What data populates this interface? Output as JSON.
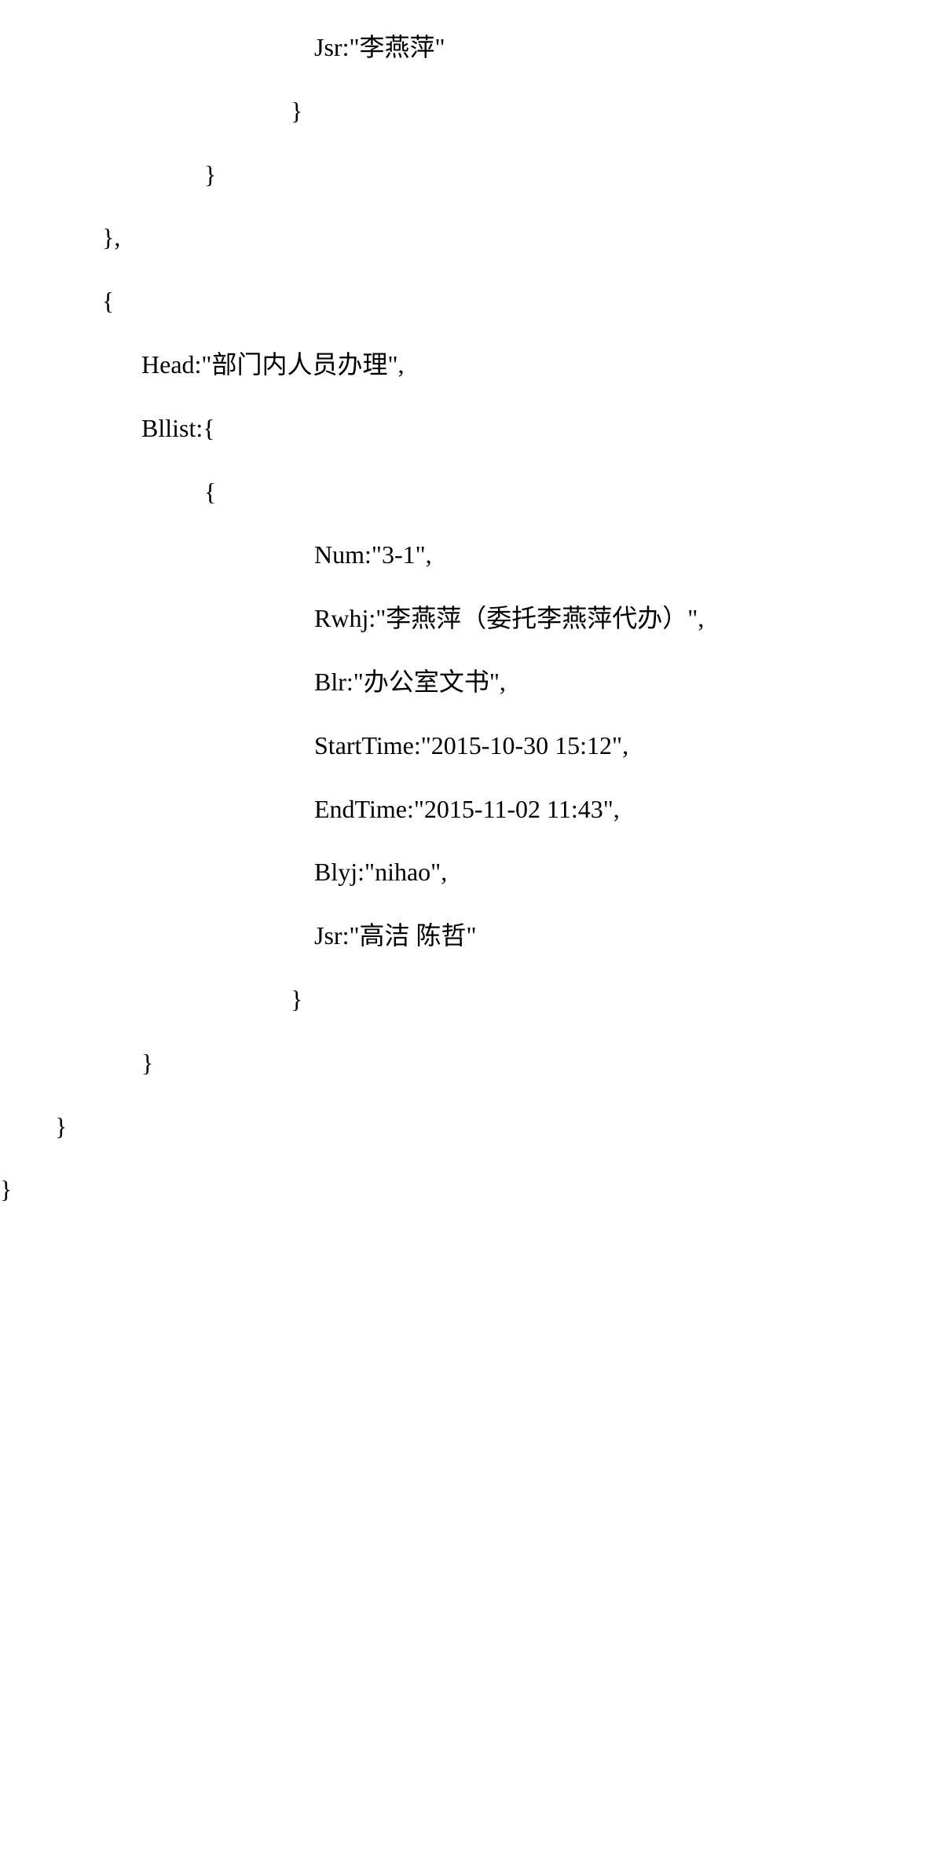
{
  "code_lines": {
    "l01": "Jsr:\"李燕萍\"",
    "l02": "}",
    "l03": "}",
    "l04": "},",
    "l05": "{",
    "l06": "Head:\"部门内人员办理\",",
    "l07": "Bllist:{",
    "l08": "{",
    "l09": "Num:\"3-1\",",
    "l10": "Rwhj:\"李燕萍（委托李燕萍代办）\",",
    "l11": "Blr:\"办公室文书\",",
    "l12": "StartTime:\"2015-10-30 15:12\",",
    "l13": "EndTime:\"2015-11-02 11:43\",",
    "l14": "Blyj:\"nihao\",",
    "l15": "Jsr:\"高洁 陈哲\"",
    "l16": "}",
    "l17": "}",
    "l18": "}",
    "l19": "}"
  }
}
